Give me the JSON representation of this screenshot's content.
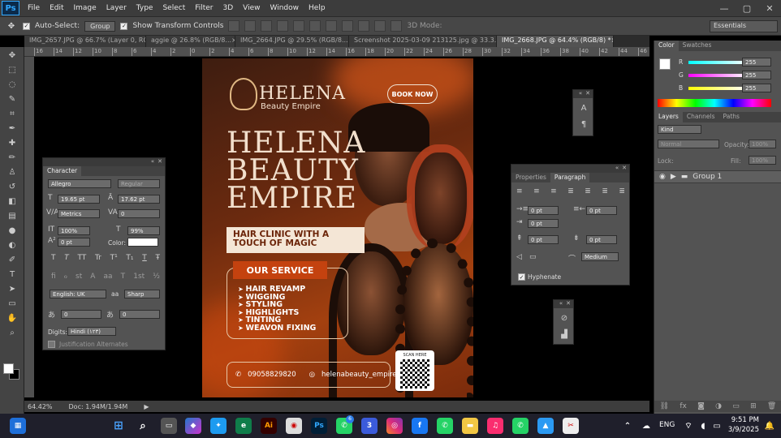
{
  "app": {
    "logo": "Ps",
    "menu": [
      "File",
      "Edit",
      "Image",
      "Layer",
      "Type",
      "Select",
      "Filter",
      "3D",
      "View",
      "Window",
      "Help"
    ],
    "window_controls": [
      "—",
      "▢",
      "✕"
    ]
  },
  "options": {
    "auto_select": "Auto-Select:",
    "group_select": "Group",
    "show_transform": "Show Transform Controls",
    "mode_3d": "3D Mode:",
    "workspace": "Essentials"
  },
  "tabs": [
    {
      "label": "IMG_2657.JPG @ 66.7% (Layer 0, RGB/...",
      "close": "×"
    },
    {
      "label": "aggie @ 26.8% (RGB/8...",
      "close": "×"
    },
    {
      "label": "IMG_2664.JPG @ 29.5% (RGB/8...",
      "close": "×"
    },
    {
      "label": "Screenshot 2025-03-09 213125.jpg @ 33.3...",
      "close": "×"
    },
    {
      "label": "IMG_2668.JPG @ 64.4% (RGB/8) *",
      "close": "×"
    }
  ],
  "ruler_ticks": [
    "16",
    "14",
    "12",
    "10",
    "8",
    "6",
    "4",
    "2",
    "0",
    "2",
    "4",
    "6",
    "8",
    "10",
    "12",
    "14",
    "16",
    "18",
    "20",
    "22",
    "24",
    "26",
    "28",
    "30",
    "32",
    "34",
    "36",
    "38",
    "40",
    "42",
    "44",
    "46"
  ],
  "status": {
    "zoom": "64.42%",
    "doc": "Doc: 1.94M/1.94M"
  },
  "poster": {
    "logo_name": "HELENA",
    "logo_sub": "Beauty Empire",
    "book_now": "BOOK NOW",
    "title_lines": [
      "HELENA",
      "BEAUTY",
      "EMPIRE"
    ],
    "tagline_1": "HAIR CLINIC WITH A",
    "tagline_2": "TOUCH OF MAGIC",
    "service_heading": "OUR SERVICE",
    "services": [
      "HAIR REVAMP",
      "WIGGING",
      "STYLING",
      "HIGHLIGHTS",
      "TINTING",
      "WEAVON FIXING"
    ],
    "phone": "09058829820",
    "instagram": "helenabeauty_empire",
    "scan": "SCAN HERE"
  },
  "character": {
    "title": "Character",
    "font": "Allegro",
    "style": "Regular",
    "size": "19.65 pt",
    "leading": "17.62 pt",
    "kerning": "Metrics",
    "tracking": "0",
    "vscale": "100%",
    "hscale": "99%",
    "baseline": "0 pt",
    "color_label": "Color:",
    "styles": [
      "T",
      "T",
      "TT",
      "Tr",
      "T¹",
      "T₁",
      "T",
      "Ŧ"
    ],
    "opentype": [
      "fi",
      "ℴ",
      "st",
      "A",
      "aa",
      "T",
      "1st",
      "½"
    ],
    "language": "English: UK",
    "aa_label": "aa",
    "antialias": "Sharp",
    "tsume": "0",
    "aki": "0",
    "digits_label": "Digits:",
    "digits": "Hindi (١٢٣)",
    "justification": "Justification Alternates"
  },
  "paragraph": {
    "tab1": "Properties",
    "tab2": "Paragraph",
    "indent_left": "0 pt",
    "indent_right": "0 pt",
    "indent_first": "0 pt",
    "space_before": "0 pt",
    "space_after": "0 pt",
    "composer": "Medium",
    "hyphenate": "Hyphenate"
  },
  "color_panel": {
    "tab1": "Color",
    "tab2": "Swatches",
    "r_label": "R",
    "g_label": "G",
    "b_label": "B",
    "r": "255",
    "g": "255",
    "b": "255"
  },
  "layers": {
    "tabs": [
      "Layers",
      "Channels",
      "Paths"
    ],
    "kind": "Kind",
    "blend": "Normal",
    "opacity_label": "Opacity:",
    "opacity": "100%",
    "lock_label": "Lock:",
    "fill_label": "Fill:",
    "fill": "100%",
    "group": "Group 1"
  },
  "system": {
    "lang": "ENG",
    "time": "9:51 PM",
    "date": "3/9/2025",
    "badge": "3",
    "whatsapp_badge": "6"
  },
  "colors": {
    "accent_orange": "#c4420f",
    "cream": "#f4e6d6",
    "ps_blue": "#31a8ff"
  }
}
